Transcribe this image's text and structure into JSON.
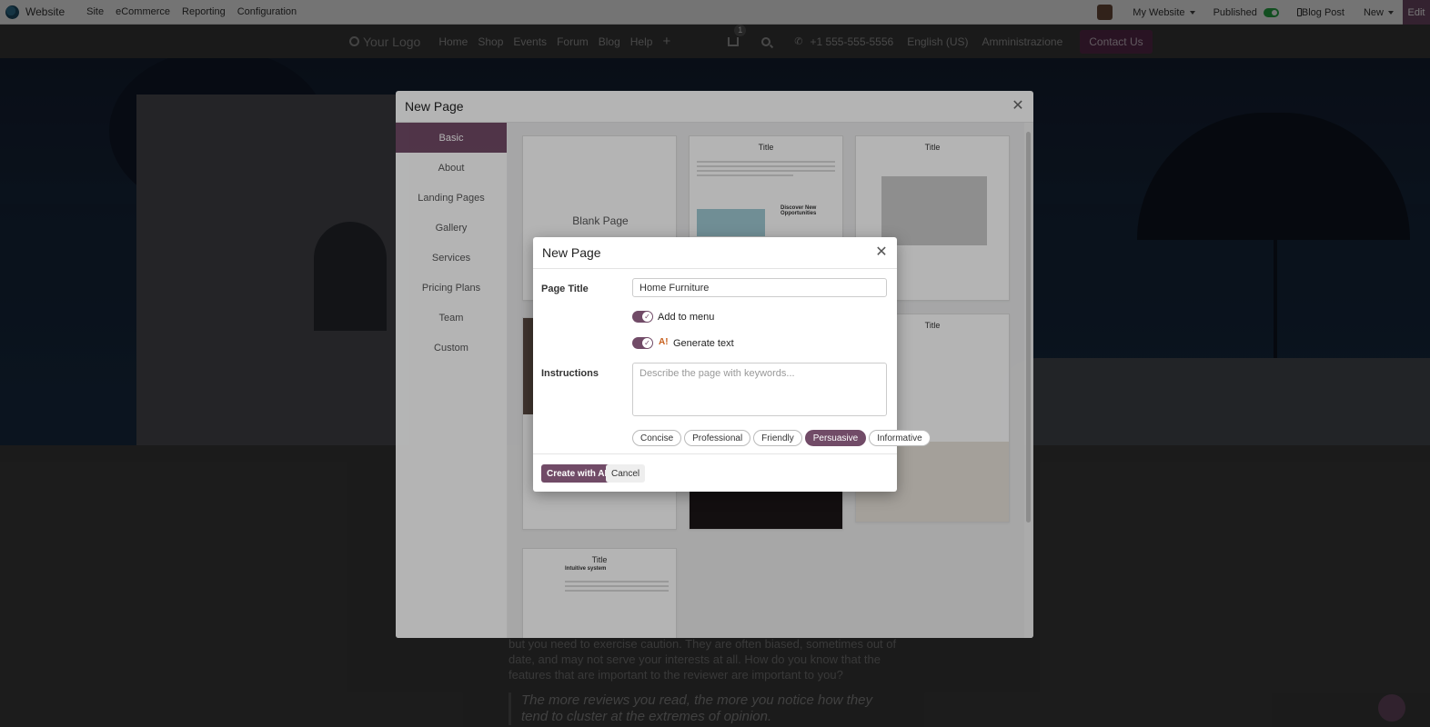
{
  "topbar": {
    "app_name": "Website",
    "menu": [
      "Site",
      "eCommerce",
      "Reporting",
      "Configuration"
    ],
    "my_website": "My Website",
    "published": "Published",
    "blog_post": "Blog Post",
    "new": "New",
    "edit": "Edit"
  },
  "site": {
    "logo_text": "Your Logo",
    "nav": [
      "Home",
      "Shop",
      "Events",
      "Forum",
      "Blog",
      "Help"
    ],
    "plus": "+",
    "cart_count": "1",
    "phone": "+1 555-555-5556",
    "language": "English (US)",
    "admin": "Amministrazione",
    "contact": "Contact Us"
  },
  "article": {
    "text": "but you need to exercise caution. They are often biased, sometimes out of date, and may not serve your interests at all. How do you know that the features that are important to the reviewer are important to you?",
    "quote": "The more reviews you read, the more you notice how they tend to cluster at the extremes of opinion."
  },
  "picker": {
    "title": "New Page",
    "categories": [
      "Basic",
      "About",
      "Landing Pages",
      "Gallery",
      "Services",
      "Pricing Plans",
      "Team",
      "Custom"
    ],
    "active_category": "Basic",
    "blank_page": "Blank Page",
    "template_title": "Title",
    "tpl2_heading": "Discover New Opportunities",
    "tpl_last_heading": "Intuitive system"
  },
  "dialog": {
    "title": "New Page",
    "page_title_label": "Page Title",
    "page_title_value": "Home Furniture",
    "add_to_menu": "Add to menu",
    "generate_text": "Generate text",
    "ai_icon": "A!",
    "instructions_label": "Instructions",
    "instructions_placeholder": "Describe the page with keywords...",
    "tones": [
      "Concise",
      "Professional",
      "Friendly",
      "Persuasive",
      "Informative"
    ],
    "active_tone": "Persuasive",
    "create_button": "Create with AI",
    "cancel_button": "Cancel"
  }
}
